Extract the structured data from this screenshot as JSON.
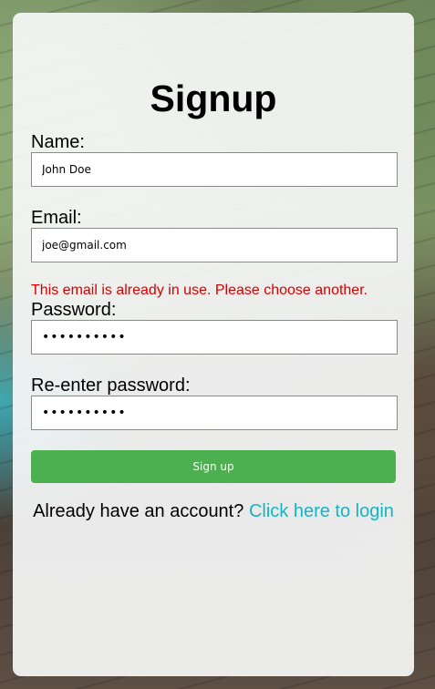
{
  "form": {
    "title": "Signup",
    "name_label": "Name:",
    "name_value": "John Doe",
    "email_label": "Email:",
    "email_value": "joe@gmail.com",
    "error_message": "This email is already in use. Please choose another.",
    "password_label": "Password:",
    "password_value": "••••••••••",
    "reenter_label": "Re-enter password:",
    "reenter_value": "••••••••••",
    "submit_label": "Sign up",
    "login_prompt": "Already have an account?",
    "login_link": "Click here to login"
  },
  "colors": {
    "error": "#d60000",
    "button": "#4caf50",
    "link": "#17b3c4"
  }
}
